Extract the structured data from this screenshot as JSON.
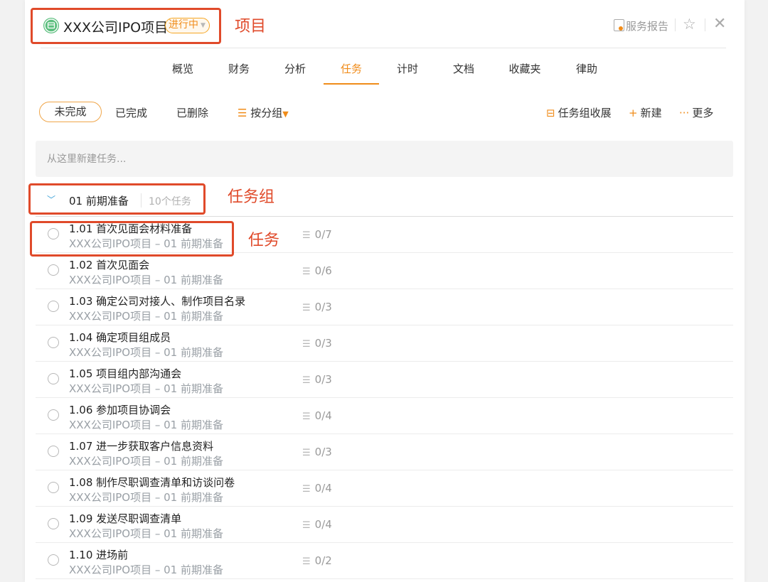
{
  "header": {
    "project_title": "XXX公司IPO项目",
    "status": "进行中",
    "report_label": "服务报告",
    "star_icon": "☆",
    "close_icon": "✕"
  },
  "annotations": {
    "project": "项目",
    "task_group": "任务组",
    "task": "任务"
  },
  "tabs": [
    {
      "label": "概览"
    },
    {
      "label": "财务"
    },
    {
      "label": "分析"
    },
    {
      "label": "任务",
      "active": true
    },
    {
      "label": "计时"
    },
    {
      "label": "文档"
    },
    {
      "label": "收藏夹"
    },
    {
      "label": "律助"
    }
  ],
  "filters": {
    "incomplete": "未完成",
    "completed": "已完成",
    "deleted": "已删除",
    "group_by": "按分组"
  },
  "toolbar": {
    "collapse_groups": "任务组收展",
    "new": "新建",
    "more": "更多"
  },
  "new_task": {
    "placeholder": "从这里新建任务..."
  },
  "group": {
    "name": "01 前期准备",
    "count": "10个任务"
  },
  "tasks": [
    {
      "title": "1.01 首次见面会材料准备",
      "subtitle": "XXX公司IPO项目 – 01 前期准备",
      "progress": "0/7"
    },
    {
      "title": "1.02 首次见面会",
      "subtitle": "XXX公司IPO项目 – 01 前期准备",
      "progress": "0/6"
    },
    {
      "title": "1.03 确定公司对接人、制作项目名录",
      "subtitle": "XXX公司IPO项目 – 01 前期准备",
      "progress": "0/3"
    },
    {
      "title": "1.04 确定项目组成员",
      "subtitle": "XXX公司IPO项目 – 01 前期准备",
      "progress": "0/3"
    },
    {
      "title": "1.05 项目组内部沟通会",
      "subtitle": "XXX公司IPO项目 – 01 前期准备",
      "progress": "0/3"
    },
    {
      "title": "1.06 参加项目协调会",
      "subtitle": "XXX公司IPO项目 – 01 前期准备",
      "progress": "0/4"
    },
    {
      "title": "1.07 进一步获取客户信息资料",
      "subtitle": "XXX公司IPO项目 – 01 前期准备",
      "progress": "0/3"
    },
    {
      "title": "1.08 制作尽职调查清单和访谈问卷",
      "subtitle": "XXX公司IPO项目 – 01 前期准备",
      "progress": "0/4"
    },
    {
      "title": "1.09 发送尽职调查清单",
      "subtitle": "XXX公司IPO项目 – 01 前期准备",
      "progress": "0/4"
    },
    {
      "title": "1.10 进场前",
      "subtitle": "XXX公司IPO项目 – 01 前期准备",
      "progress": "0/2"
    }
  ],
  "colors": {
    "accent": "#f08c1a",
    "annotation": "#e04a2a",
    "project_icon": "#5cbf7e",
    "chevron": "#3aa0d8"
  }
}
